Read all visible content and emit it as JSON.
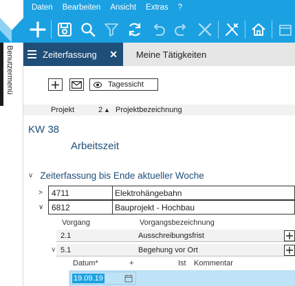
{
  "menu": {
    "items": [
      {
        "label": "Daten"
      },
      {
        "label": "Bearbeiten"
      },
      {
        "label": "Ansicht"
      },
      {
        "label": "Extras"
      },
      {
        "label": "?"
      }
    ]
  },
  "toolbar": {
    "icons": [
      "plus-icon",
      "save-icon",
      "search-icon",
      "filter-icon",
      "refresh-icon",
      "undo-icon",
      "redo-icon",
      "close-icon",
      "tools-icon",
      "home-icon"
    ]
  },
  "sidebar": {
    "label": "Benutzermenü"
  },
  "tabs": [
    {
      "label": "Zeiterfassung",
      "active": true
    },
    {
      "label": "Meine Tätigkeiten",
      "active": false
    }
  ],
  "actions": {
    "day_view_label": "Tagessicht"
  },
  "columns": {
    "projekt": "Projekt",
    "sort_number": "2",
    "projektbezeichnung": "Projektbezeichnung"
  },
  "week": {
    "label": "KW 38",
    "section": "Arbeitszeit"
  },
  "group": {
    "label": "Zeiterfassung bis Ende aktueller Woche"
  },
  "projects": [
    {
      "number": "4711",
      "name": "Elektrohängebahn",
      "expanded": false
    },
    {
      "number": "6812",
      "name": "Bauprojekt - Hochbau",
      "expanded": true
    }
  ],
  "subcolumns": {
    "vorgang": "Vorgang",
    "vorgangsbezeichnung": "Vorgangsbezeichnung"
  },
  "tasks": [
    {
      "number": "2.1",
      "name": "Ausschreibungsfrist"
    },
    {
      "number": "5.1",
      "name": "Begehung vor Ort"
    }
  ],
  "entry_columns": {
    "datum": "Datum*",
    "plus": "+",
    "ist": "Ist",
    "kommentar": "Kommentar"
  },
  "entry": {
    "date": "19.09.19"
  },
  "colors": {
    "accent": "#1ba1e2",
    "tab_active": "#1f4e79",
    "selected_row": "#bfe3f6"
  }
}
